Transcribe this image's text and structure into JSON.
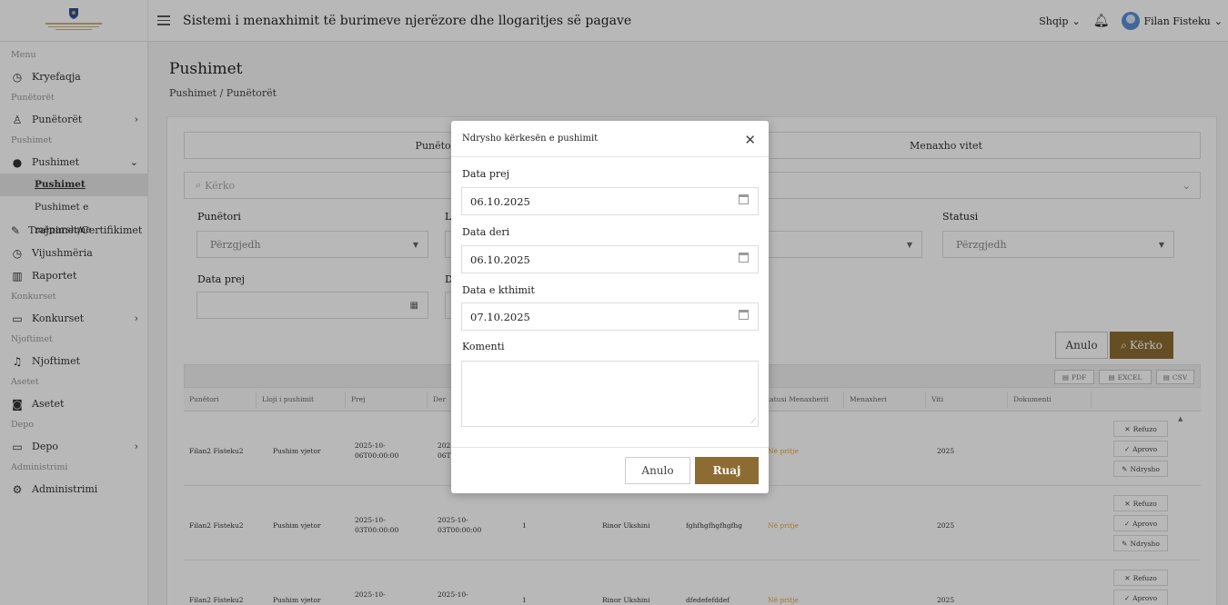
{
  "header": {
    "title": "Sistemi i menaxhimit të burimeve njerëzore dhe llogaritjes së pagave",
    "language": "Shqip",
    "user": "Filan Fisteku"
  },
  "sidebar": {
    "menu_label": "Menu",
    "home": "Kryefaqja",
    "sec_workers": "Punëtorët",
    "workers": "Punëtorët",
    "sec_leave": "Pushimet",
    "leave": "Pushimet",
    "leave_sub": "Pushimet",
    "leave_prev": "Pushimet e mëparshme",
    "trainings": "Trajnimet/Certifikimet",
    "attendance": "Vijushmëria",
    "reports": "Raportet",
    "sec_contests": "Konkurset",
    "contests": "Konkurset",
    "sec_notices": "Njoftimet",
    "notices": "Njoftimet",
    "sec_assets": "Asetet",
    "assets": "Asetet",
    "sec_depot": "Depo",
    "depot": "Depo",
    "sec_admin": "Administrimi",
    "admin": "Administrimi"
  },
  "page": {
    "title": "Pushimet",
    "breadcrumb": "Pushimet / Punëtorët"
  },
  "tabs": {
    "t1": "Punëtorë",
    "t2": "Menaxho vitet"
  },
  "search": {
    "placeholder": "Kërko"
  },
  "filters": {
    "worker_label": "Punëtori",
    "worker_value": "Përzgjedh",
    "type_label": "Ll",
    "status_label": "Statusi",
    "status_value": "Përzgjedh",
    "from_label": "Data prej",
    "to_label": "D"
  },
  "buttons": {
    "cancel": "Anulo",
    "search": "Kërko"
  },
  "export": {
    "pdf": "PDF",
    "excel": "EXCEL",
    "csv": "CSV"
  },
  "table": {
    "headers": {
      "worker": "Punëtori",
      "type": "Lloji i pushimit",
      "from": "Prej",
      "to": "Der",
      "mgr_status": "Statusi Menaxherit",
      "manager": "Menaxheri",
      "year": "Viti",
      "doc": "Dokumenti"
    },
    "rows": [
      {
        "worker": "Filan2 Fisteku2",
        "type": "Pushim vjetor",
        "from1": "2025-10-",
        "from2": "06T00:00:00",
        "to1": "202",
        "to2": "06T",
        "status": "Në pritje",
        "year": "2025"
      },
      {
        "worker": "Filan2 Fisteku2",
        "type": "Pushim vjetor",
        "from1": "2025-10-",
        "from2": "03T00:00:00",
        "to1": "2025-10-",
        "to2": "03T00:00:00",
        "days": "1",
        "manager": "Rinor Ukshini",
        "comment": "fghfhgfhgfhgfhg",
        "status": "Në pritje",
        "year": "2025"
      },
      {
        "worker": "Filan2 Fisteku2",
        "type": "Pushim vjetor",
        "from1": "2025-10-",
        "to1": "2025-10-",
        "days": "1",
        "manager": "Rinor Ukshini",
        "comment": "dfedefefddef",
        "status": "Në pritje",
        "year": "2025"
      }
    ],
    "actions": {
      "reject": "Refuzo",
      "approve": "Aprovo",
      "edit": "Ndrysho"
    }
  },
  "modal": {
    "title": "Ndrysho kërkesën e pushimit",
    "from_label": "Data prej",
    "from_value": "06.10.2025",
    "to_label": "Data deri",
    "to_value": "06.10.2025",
    "return_label": "Data e kthimit",
    "return_value": "07.10.2025",
    "comment_label": "Komenti",
    "cancel": "Anulo",
    "save": "Ruaj"
  }
}
